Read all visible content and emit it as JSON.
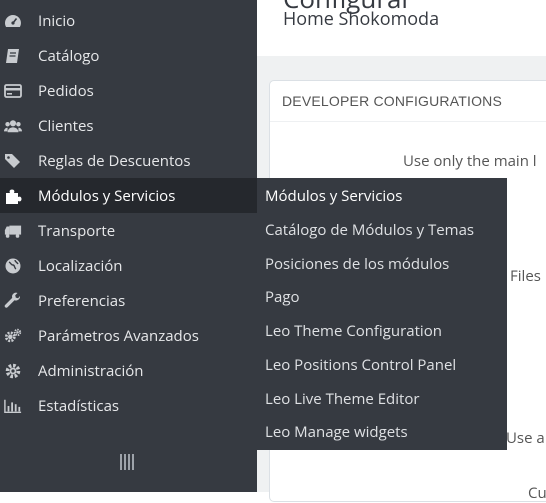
{
  "sidebar": {
    "items": [
      {
        "label": "Inicio",
        "icon": "dashboard-icon"
      },
      {
        "label": "Catálogo",
        "icon": "book-icon"
      },
      {
        "label": "Pedidos",
        "icon": "credit-card-icon"
      },
      {
        "label": "Clientes",
        "icon": "users-icon"
      },
      {
        "label": "Reglas de Descuentos",
        "icon": "tags-icon"
      },
      {
        "label": "Módulos y Servicios",
        "icon": "puzzle-icon",
        "active": true
      },
      {
        "label": "Transporte",
        "icon": "truck-icon"
      },
      {
        "label": "Localización",
        "icon": "globe-icon"
      },
      {
        "label": "Preferencias",
        "icon": "wrench-icon"
      },
      {
        "label": "Parámetros Avanzados",
        "icon": "cogs-icon"
      },
      {
        "label": "Administración",
        "icon": "gear-icon"
      },
      {
        "label": "Estadísticas",
        "icon": "bar-chart-icon"
      }
    ]
  },
  "submenu": {
    "title": "Módulos y Servicios",
    "items": [
      "Catálogo de Módulos y Temas",
      "Posiciones de los módulos",
      "Pago",
      "Leo Theme Configuration",
      "Leo Positions Control Panel",
      "Leo Live Theme Editor",
      "Leo Manage widgets"
    ]
  },
  "header": {
    "title": "Configurar",
    "subtitle": "Home Shokomoda"
  },
  "panel": {
    "heading": "DEVELOPER CONFIGURATIONS",
    "text1": "Use only the main l",
    "text2": "Files",
    "text3": "Use a",
    "text4": "Cust"
  },
  "colors": {
    "sidebar_bg": "#363a41",
    "active_bg": "#25282d"
  }
}
